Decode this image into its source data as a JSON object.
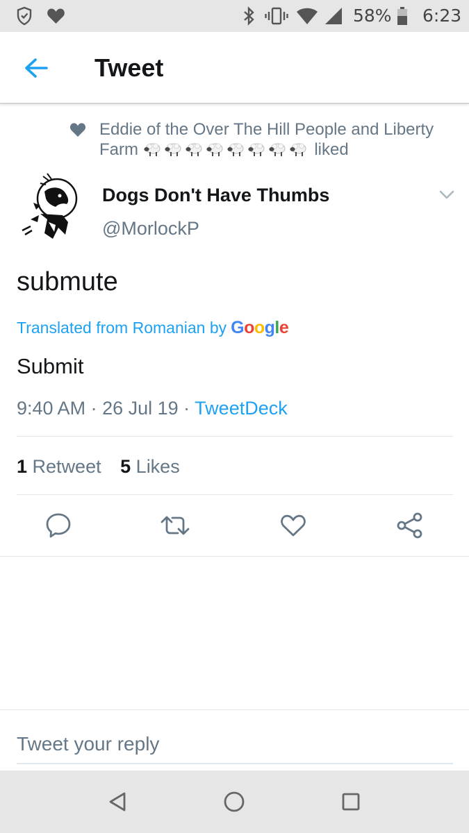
{
  "status_bar": {
    "battery": "58%",
    "time": "6:23",
    "icons": [
      "shield-icon",
      "heart-icon",
      "bluetooth-icon",
      "vibrate-icon",
      "wifi-icon",
      "signal-icon",
      "battery-icon"
    ]
  },
  "header": {
    "title": "Tweet",
    "back_icon": "back-arrow-icon"
  },
  "social_context": {
    "line1": "Eddie of the Over The Hill People and Liberty",
    "line2_prefix": "Farm",
    "sheep_count": 8,
    "line2_suffix": "liked"
  },
  "tweet": {
    "author_name": "Dogs Don't Have Thumbs",
    "author_handle": "@MorlockP",
    "text": "submute",
    "translated_label": "Translated from Romanian by",
    "translated_brand": "Google",
    "translation": "Submit",
    "time": "9:40 AM",
    "date": "26 Jul 19",
    "source": "TweetDeck",
    "retweet_count": "1",
    "retweet_label": "Retweet",
    "like_count": "5",
    "like_label": "Likes"
  },
  "actions": [
    "reply-icon",
    "retweet-icon",
    "like-icon",
    "share-icon"
  ],
  "reply": {
    "placeholder": "Tweet your reply"
  },
  "colors": {
    "accent": "#1da1f2",
    "secondary_text": "#657786",
    "primary_text": "#14171a",
    "divider": "#e1e8ed",
    "system_bar": "#e6e6e6"
  }
}
